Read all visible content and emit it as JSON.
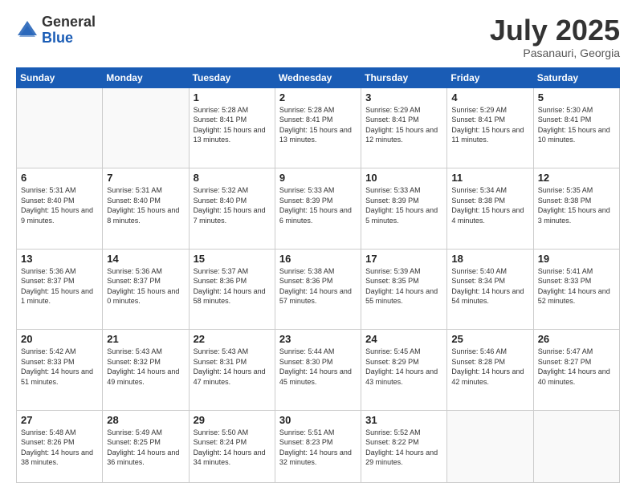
{
  "header": {
    "logo_general": "General",
    "logo_blue": "Blue",
    "month_title": "July 2025",
    "location": "Pasanauri, Georgia"
  },
  "weekdays": [
    "Sunday",
    "Monday",
    "Tuesday",
    "Wednesday",
    "Thursday",
    "Friday",
    "Saturday"
  ],
  "weeks": [
    [
      {
        "day": "",
        "sunrise": "",
        "sunset": "",
        "daylight": ""
      },
      {
        "day": "",
        "sunrise": "",
        "sunset": "",
        "daylight": ""
      },
      {
        "day": "1",
        "sunrise": "Sunrise: 5:28 AM",
        "sunset": "Sunset: 8:41 PM",
        "daylight": "Daylight: 15 hours and 13 minutes."
      },
      {
        "day": "2",
        "sunrise": "Sunrise: 5:28 AM",
        "sunset": "Sunset: 8:41 PM",
        "daylight": "Daylight: 15 hours and 13 minutes."
      },
      {
        "day": "3",
        "sunrise": "Sunrise: 5:29 AM",
        "sunset": "Sunset: 8:41 PM",
        "daylight": "Daylight: 15 hours and 12 minutes."
      },
      {
        "day": "4",
        "sunrise": "Sunrise: 5:29 AM",
        "sunset": "Sunset: 8:41 PM",
        "daylight": "Daylight: 15 hours and 11 minutes."
      },
      {
        "day": "5",
        "sunrise": "Sunrise: 5:30 AM",
        "sunset": "Sunset: 8:41 PM",
        "daylight": "Daylight: 15 hours and 10 minutes."
      }
    ],
    [
      {
        "day": "6",
        "sunrise": "Sunrise: 5:31 AM",
        "sunset": "Sunset: 8:40 PM",
        "daylight": "Daylight: 15 hours and 9 minutes."
      },
      {
        "day": "7",
        "sunrise": "Sunrise: 5:31 AM",
        "sunset": "Sunset: 8:40 PM",
        "daylight": "Daylight: 15 hours and 8 minutes."
      },
      {
        "day": "8",
        "sunrise": "Sunrise: 5:32 AM",
        "sunset": "Sunset: 8:40 PM",
        "daylight": "Daylight: 15 hours and 7 minutes."
      },
      {
        "day": "9",
        "sunrise": "Sunrise: 5:33 AM",
        "sunset": "Sunset: 8:39 PM",
        "daylight": "Daylight: 15 hours and 6 minutes."
      },
      {
        "day": "10",
        "sunrise": "Sunrise: 5:33 AM",
        "sunset": "Sunset: 8:39 PM",
        "daylight": "Daylight: 15 hours and 5 minutes."
      },
      {
        "day": "11",
        "sunrise": "Sunrise: 5:34 AM",
        "sunset": "Sunset: 8:38 PM",
        "daylight": "Daylight: 15 hours and 4 minutes."
      },
      {
        "day": "12",
        "sunrise": "Sunrise: 5:35 AM",
        "sunset": "Sunset: 8:38 PM",
        "daylight": "Daylight: 15 hours and 3 minutes."
      }
    ],
    [
      {
        "day": "13",
        "sunrise": "Sunrise: 5:36 AM",
        "sunset": "Sunset: 8:37 PM",
        "daylight": "Daylight: 15 hours and 1 minute."
      },
      {
        "day": "14",
        "sunrise": "Sunrise: 5:36 AM",
        "sunset": "Sunset: 8:37 PM",
        "daylight": "Daylight: 15 hours and 0 minutes."
      },
      {
        "day": "15",
        "sunrise": "Sunrise: 5:37 AM",
        "sunset": "Sunset: 8:36 PM",
        "daylight": "Daylight: 14 hours and 58 minutes."
      },
      {
        "day": "16",
        "sunrise": "Sunrise: 5:38 AM",
        "sunset": "Sunset: 8:36 PM",
        "daylight": "Daylight: 14 hours and 57 minutes."
      },
      {
        "day": "17",
        "sunrise": "Sunrise: 5:39 AM",
        "sunset": "Sunset: 8:35 PM",
        "daylight": "Daylight: 14 hours and 55 minutes."
      },
      {
        "day": "18",
        "sunrise": "Sunrise: 5:40 AM",
        "sunset": "Sunset: 8:34 PM",
        "daylight": "Daylight: 14 hours and 54 minutes."
      },
      {
        "day": "19",
        "sunrise": "Sunrise: 5:41 AM",
        "sunset": "Sunset: 8:33 PM",
        "daylight": "Daylight: 14 hours and 52 minutes."
      }
    ],
    [
      {
        "day": "20",
        "sunrise": "Sunrise: 5:42 AM",
        "sunset": "Sunset: 8:33 PM",
        "daylight": "Daylight: 14 hours and 51 minutes."
      },
      {
        "day": "21",
        "sunrise": "Sunrise: 5:43 AM",
        "sunset": "Sunset: 8:32 PM",
        "daylight": "Daylight: 14 hours and 49 minutes."
      },
      {
        "day": "22",
        "sunrise": "Sunrise: 5:43 AM",
        "sunset": "Sunset: 8:31 PM",
        "daylight": "Daylight: 14 hours and 47 minutes."
      },
      {
        "day": "23",
        "sunrise": "Sunrise: 5:44 AM",
        "sunset": "Sunset: 8:30 PM",
        "daylight": "Daylight: 14 hours and 45 minutes."
      },
      {
        "day": "24",
        "sunrise": "Sunrise: 5:45 AM",
        "sunset": "Sunset: 8:29 PM",
        "daylight": "Daylight: 14 hours and 43 minutes."
      },
      {
        "day": "25",
        "sunrise": "Sunrise: 5:46 AM",
        "sunset": "Sunset: 8:28 PM",
        "daylight": "Daylight: 14 hours and 42 minutes."
      },
      {
        "day": "26",
        "sunrise": "Sunrise: 5:47 AM",
        "sunset": "Sunset: 8:27 PM",
        "daylight": "Daylight: 14 hours and 40 minutes."
      }
    ],
    [
      {
        "day": "27",
        "sunrise": "Sunrise: 5:48 AM",
        "sunset": "Sunset: 8:26 PM",
        "daylight": "Daylight: 14 hours and 38 minutes."
      },
      {
        "day": "28",
        "sunrise": "Sunrise: 5:49 AM",
        "sunset": "Sunset: 8:25 PM",
        "daylight": "Daylight: 14 hours and 36 minutes."
      },
      {
        "day": "29",
        "sunrise": "Sunrise: 5:50 AM",
        "sunset": "Sunset: 8:24 PM",
        "daylight": "Daylight: 14 hours and 34 minutes."
      },
      {
        "day": "30",
        "sunrise": "Sunrise: 5:51 AM",
        "sunset": "Sunset: 8:23 PM",
        "daylight": "Daylight: 14 hours and 32 minutes."
      },
      {
        "day": "31",
        "sunrise": "Sunrise: 5:52 AM",
        "sunset": "Sunset: 8:22 PM",
        "daylight": "Daylight: 14 hours and 29 minutes."
      },
      {
        "day": "",
        "sunrise": "",
        "sunset": "",
        "daylight": ""
      },
      {
        "day": "",
        "sunrise": "",
        "sunset": "",
        "daylight": ""
      }
    ]
  ]
}
